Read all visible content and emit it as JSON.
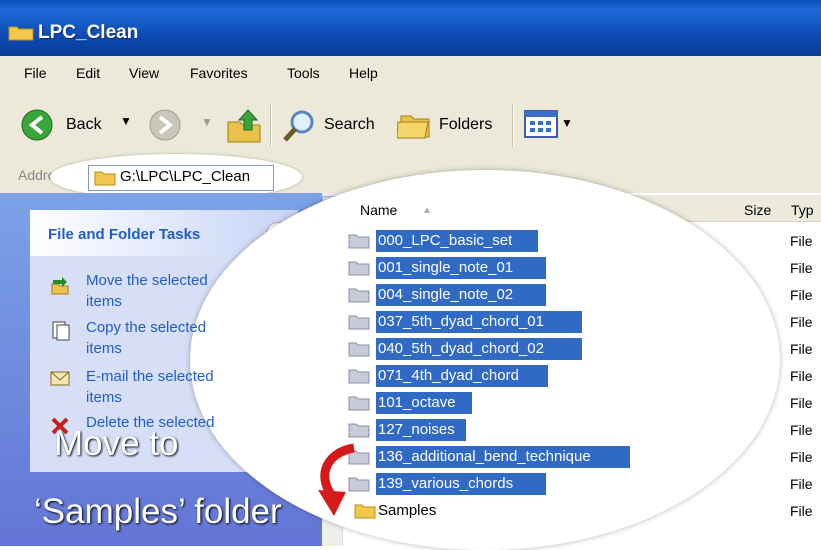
{
  "window": {
    "title": "LPC_Clean"
  },
  "menu": {
    "items": [
      "File",
      "Edit",
      "View",
      "Favorites",
      "Tools",
      "Help"
    ]
  },
  "toolbar": {
    "back": "Back",
    "search": "Search",
    "folders": "Folders"
  },
  "address": {
    "label": "Address",
    "value": "G:\\LPC\\LPC_Clean"
  },
  "tasks": {
    "title": "File and Folder Tasks",
    "items": [
      {
        "line1": "Move the selected",
        "line2": "items",
        "icon": "move-icon"
      },
      {
        "line1": "Copy the selected",
        "line2": "items",
        "icon": "copy-icon"
      },
      {
        "line1": "E-mail the selected",
        "line2": "items",
        "icon": "email-icon"
      },
      {
        "line1": "Delete the selected",
        "line2": "",
        "icon": "delete-icon"
      }
    ]
  },
  "list": {
    "columns": {
      "name": "Name",
      "size": "Size",
      "type": "Typ"
    },
    "rows": [
      {
        "name": "000_LPC_basic_set",
        "type": "File",
        "selected": true
      },
      {
        "name": "001_single_note_01",
        "type": "File",
        "selected": true
      },
      {
        "name": "004_single_note_02",
        "type": "File",
        "selected": true
      },
      {
        "name": "037_5th_dyad_chord_01",
        "type": "File",
        "selected": true
      },
      {
        "name": "040_5th_dyad_chord_02",
        "type": "File",
        "selected": true
      },
      {
        "name": "071_4th_dyad_chord",
        "type": "File",
        "selected": true
      },
      {
        "name": "101_octave",
        "type": "File",
        "selected": true
      },
      {
        "name": "127_noises",
        "type": "File",
        "selected": true
      },
      {
        "name": "136_additional_bend_technique",
        "type": "File",
        "selected": true
      },
      {
        "name": "139_various_chords",
        "type": "File",
        "selected": true
      },
      {
        "name": "Samples",
        "type": "File",
        "selected": false
      }
    ]
  },
  "captions": {
    "line1": "Move to",
    "line2": "‘Samples’ folder"
  },
  "colors": {
    "selection": "#316ac5",
    "title_bar": "#0a4fb8",
    "task_link": "#215dc6"
  }
}
